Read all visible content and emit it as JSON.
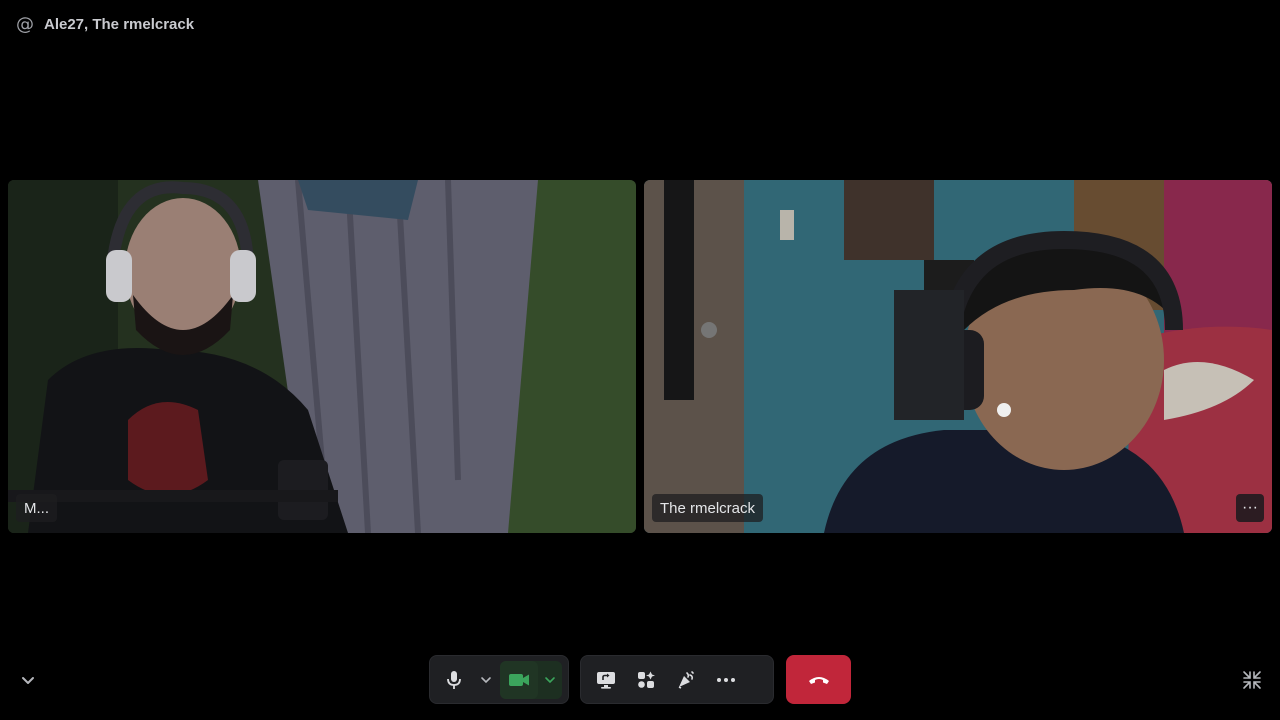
{
  "header": {
    "icon": "at-sign-icon",
    "at_symbol": "@",
    "title": "Ale27, The rmelcrack"
  },
  "participants": [
    {
      "display_name": "M...",
      "has_video": true
    },
    {
      "display_name": "The rmelcrack",
      "has_video": true,
      "more_label": "···"
    }
  ],
  "controls": {
    "microphone": {
      "icon": "microphone-icon",
      "options_icon": "chevron-down-icon"
    },
    "camera": {
      "icon": "video-camera-icon",
      "options_icon": "chevron-down-icon",
      "state": "on"
    },
    "actions": [
      {
        "icon": "screen-share-icon"
      },
      {
        "icon": "activities-icon"
      },
      {
        "icon": "soundboard-icon"
      },
      {
        "icon": "more-horizontal-icon"
      }
    ],
    "end_call": {
      "icon": "phone-hangup-icon"
    },
    "collapse": {
      "icon": "chevron-down-icon"
    },
    "minimize": {
      "icon": "minimize-icon"
    }
  },
  "colors": {
    "background": "#000000",
    "control_bar": "#1f2023",
    "camera_active": "#3ba55c",
    "end_call": "#c1263a",
    "text": "#dcdde0"
  }
}
